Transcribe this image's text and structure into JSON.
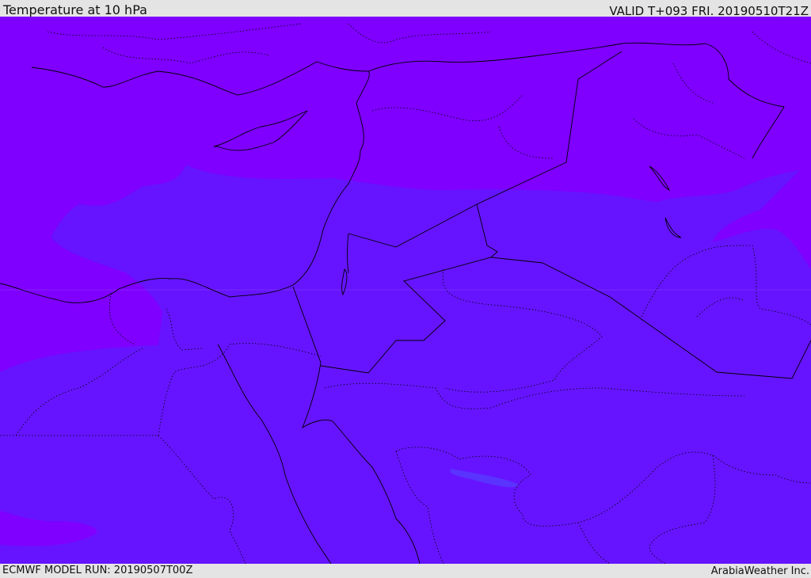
{
  "header": {
    "title": "Temperature at 10 hPa",
    "valid": "VALID T+093 FRI. 20190510T21Z"
  },
  "footer": {
    "model_run": "ECMWF MODEL RUN: 20190507T00Z",
    "credit": "ArabiaWeather Inc."
  },
  "colors": {
    "cold_band": "#7f00ff",
    "warm_band": "#6614ff",
    "warmest_patch": "#5a33ff",
    "borders": "#000000"
  }
}
